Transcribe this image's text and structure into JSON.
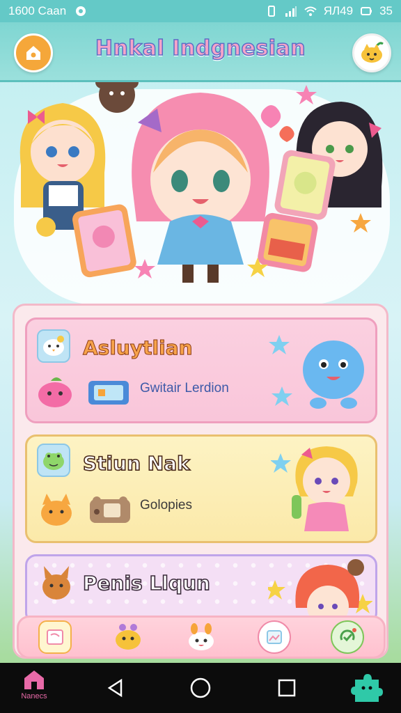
{
  "status_bar": {
    "time": "1600 Caan",
    "right_text": "ЯЛ49",
    "battery": "35"
  },
  "header": {
    "title": "Hnkal Indgnesian"
  },
  "cards": [
    {
      "title": "Asluytlian",
      "subtitle": "Gwitair Lerdion"
    },
    {
      "title": "Stiun Nak",
      "subtitle": "Golopies"
    },
    {
      "title": "Penis Llqun"
    }
  ],
  "nav": {
    "home_label": "Nanecs"
  },
  "colors": {
    "status_bar": "#64c9c7",
    "header": "#7fd6d2",
    "accent_pink": "#f6a3c8",
    "home_button": "#f5a73a"
  }
}
